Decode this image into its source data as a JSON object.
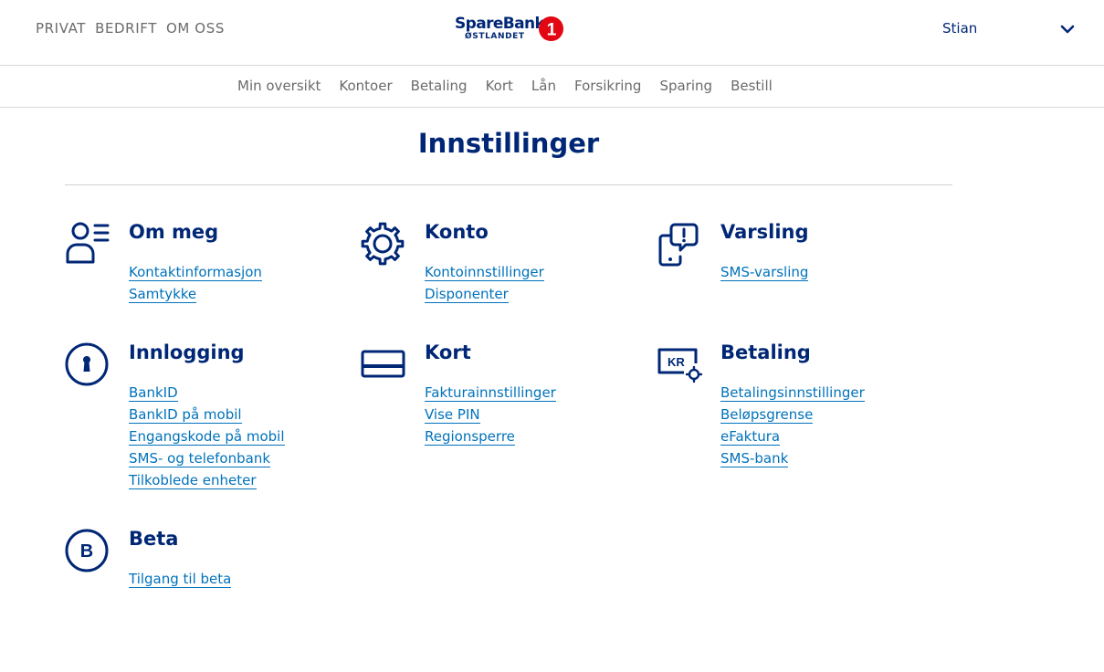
{
  "header": {
    "segments": [
      "PRIVAT",
      "BEDRIFT",
      "OM OSS"
    ],
    "logo_line1": "SpareBank",
    "logo_line2": "ØSTLANDET",
    "logo_badge": "1",
    "user_name": "Stian",
    "user_menu_icon": "chevron-down-icon"
  },
  "main_nav": [
    "Min oversikt",
    "Kontoer",
    "Betaling",
    "Kort",
    "Lån",
    "Forsikring",
    "Sparing",
    "Bestill"
  ],
  "page": {
    "title": "Innstillinger"
  },
  "colors": {
    "brand_blue": "#002776",
    "link_blue": "#0072bc",
    "logo_red": "#e30613"
  },
  "sections": [
    {
      "title": "Om meg",
      "icon": "person-list-icon",
      "links": [
        "Kontaktinformasjon",
        "Samtykke"
      ]
    },
    {
      "title": "Konto",
      "icon": "gear-icon",
      "links": [
        "Kontoinnstillinger",
        "Disponenter"
      ]
    },
    {
      "title": "Varsling",
      "icon": "phone-alert-icon",
      "links": [
        "SMS-varsling"
      ]
    },
    {
      "title": "Innlogging",
      "icon": "keyhole-icon",
      "links": [
        "BankID",
        "BankID på mobil",
        "Engangskode på mobil",
        "SMS- og telefonbank",
        "Tilkoblede enheter"
      ]
    },
    {
      "title": "Kort",
      "icon": "card-icon",
      "links": [
        "Fakturainnstillinger",
        "Vise PIN",
        "Regionsperre"
      ]
    },
    {
      "title": "Betaling",
      "icon": "kr-settings-icon",
      "links": [
        "Betalingsinnstillinger",
        "Beløpsgrense",
        "eFaktura",
        "SMS-bank"
      ]
    },
    {
      "title": "Beta",
      "icon": "beta-icon",
      "links": [
        "Tilgang til beta"
      ]
    }
  ]
}
